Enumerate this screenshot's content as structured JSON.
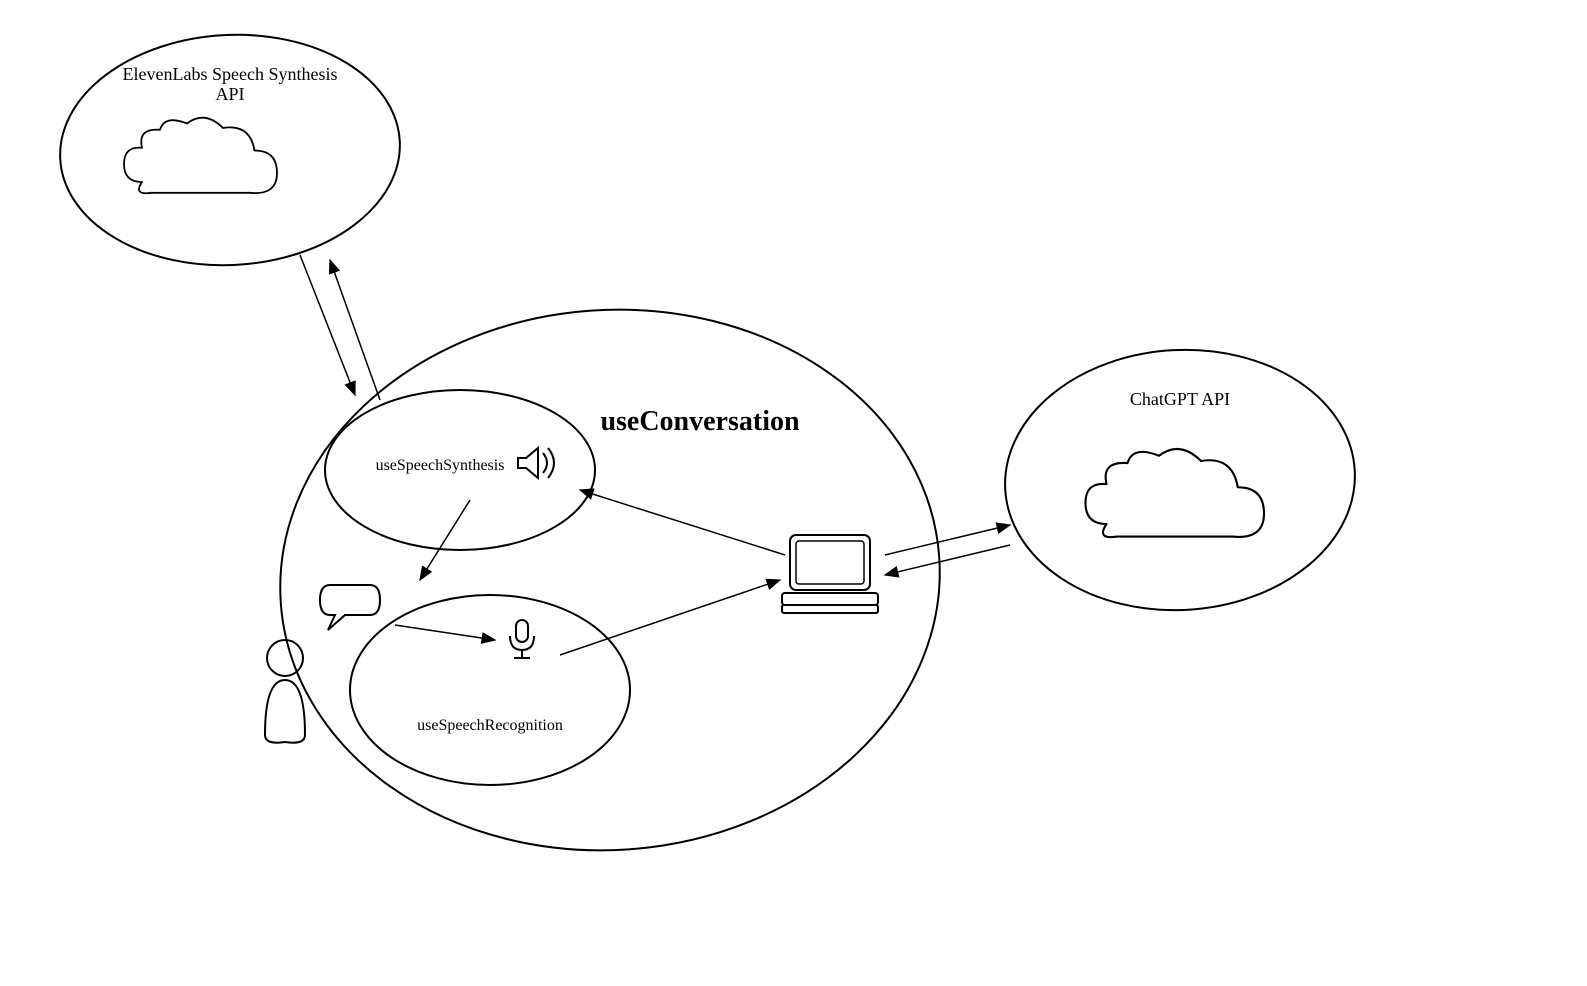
{
  "nodes": {
    "elevenlabs": {
      "title_line1": "ElevenLabs Speech Synthesis",
      "title_line2": "API"
    },
    "chatgpt": {
      "title": "ChatGPT API"
    },
    "conversation": {
      "title": "useConversation"
    },
    "synthesis": {
      "title": "useSpeechSynthesis"
    },
    "recognition": {
      "title": "useSpeechRecognition"
    }
  },
  "icons": {
    "cloud1": "cloud-icon",
    "cloud2": "cloud-icon",
    "speaker": "speaker-icon",
    "microphone": "microphone-icon",
    "speech_bubble": "speech-bubble-icon",
    "person": "person-icon",
    "computer": "computer-icon"
  }
}
